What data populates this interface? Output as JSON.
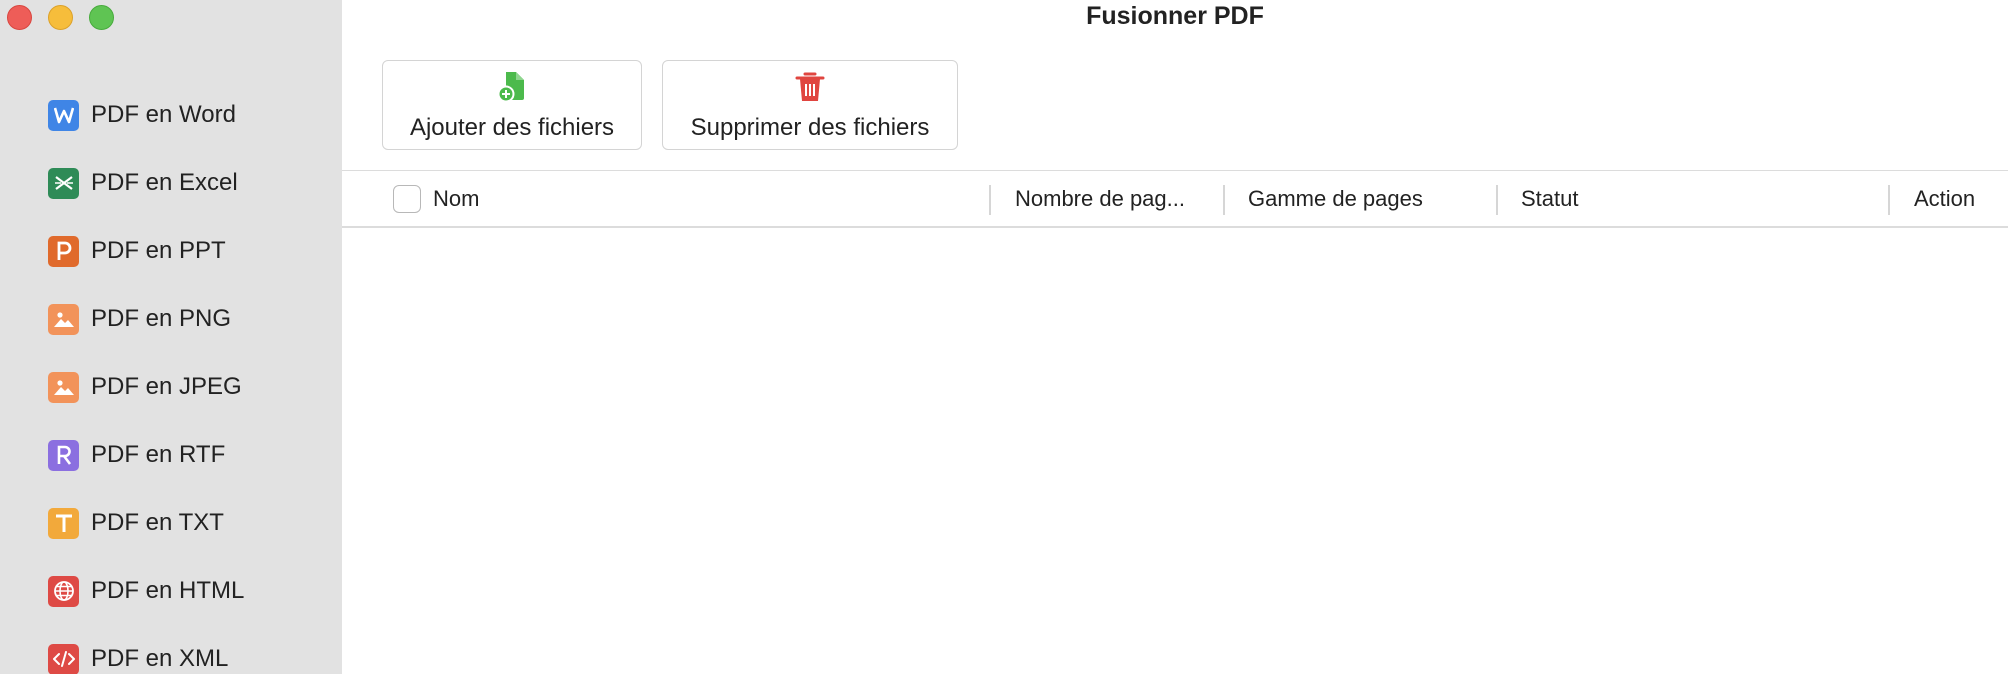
{
  "window": {
    "title": "Fusionner PDF"
  },
  "sidebar": {
    "items": [
      {
        "label": "PDF en Word",
        "icon": "word-icon",
        "color": "#3f85e6",
        "glyph": "W"
      },
      {
        "label": "PDF en Excel",
        "icon": "excel-icon",
        "color": "#2e8b57",
        "glyph": "✕"
      },
      {
        "label": "PDF en PPT",
        "icon": "ppt-icon",
        "color": "#e06a2c",
        "glyph": "P"
      },
      {
        "label": "PDF en PNG",
        "icon": "image-icon",
        "color": "#f2935a",
        "glyph": "img"
      },
      {
        "label": "PDF en JPEG",
        "icon": "image-icon",
        "color": "#f2935a",
        "glyph": "img"
      },
      {
        "label": "PDF en RTF",
        "icon": "rtf-icon",
        "color": "#8b6fe0",
        "glyph": "R"
      },
      {
        "label": "PDF en TXT",
        "icon": "txt-icon",
        "color": "#f2a93b",
        "glyph": "T"
      },
      {
        "label": "PDF en HTML",
        "icon": "globe-icon",
        "color": "#de4a45",
        "glyph": "globe"
      },
      {
        "label": "PDF en XML",
        "icon": "code-icon",
        "color": "#de4a45",
        "glyph": "code"
      }
    ]
  },
  "toolbar": {
    "add_label": "Ajouter des fichiers",
    "add_icon": "add-file-icon",
    "add_color": "#4cba4c",
    "delete_label": "Supprimer des fichiers",
    "delete_icon": "trash-icon",
    "delete_color": "#e0453f"
  },
  "table": {
    "columns": {
      "name": "Nom",
      "pages": "Nombre de pag...",
      "range": "Gamme de pages",
      "status": "Statut",
      "action": "Action"
    },
    "rows": []
  }
}
